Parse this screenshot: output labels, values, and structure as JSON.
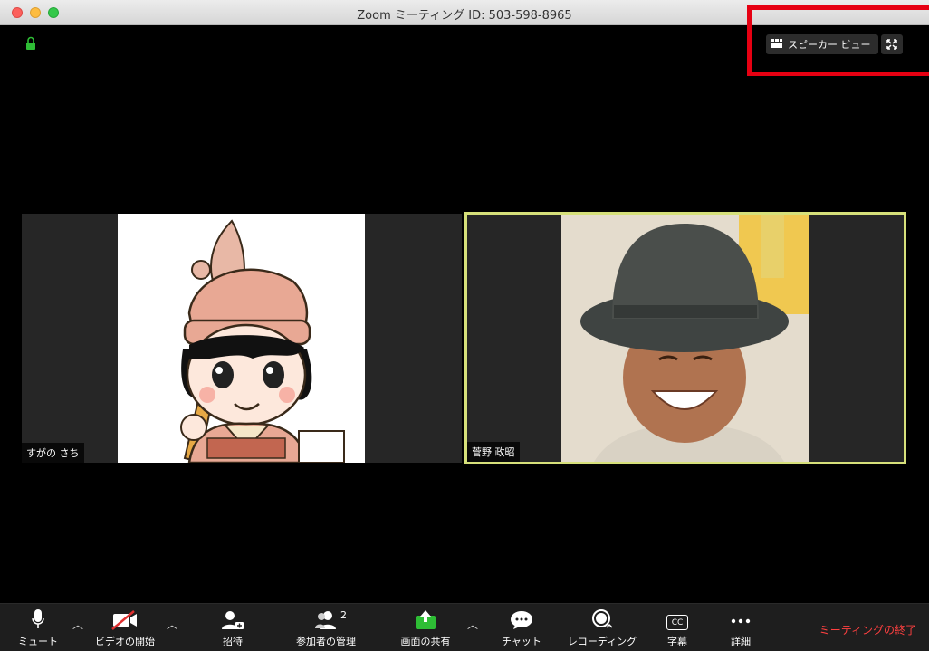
{
  "window": {
    "title": "Zoom ミーティング ID: 503-598-8965"
  },
  "top_controls": {
    "speaker_view_label": "スピーカー ビュー"
  },
  "participants": [
    {
      "name": "すがの さち"
    },
    {
      "name": "菅野 政昭"
    }
  ],
  "toolbar": {
    "mute": "ミュート",
    "start_video": "ビデオの開始",
    "invite": "招待",
    "manage_participants": "参加者の管理",
    "participant_count": "2",
    "share_screen": "画面の共有",
    "chat": "チャット",
    "recording": "レコーディング",
    "captions": "字幕",
    "captions_icon_text": "CC",
    "more": "詳細",
    "end_meeting": "ミーティングの終了"
  },
  "colors": {
    "active_speaker_border": "#d6e07a",
    "highlight_box": "#e60012",
    "share_green": "#2ebd35",
    "end_red": "#ff4040"
  }
}
